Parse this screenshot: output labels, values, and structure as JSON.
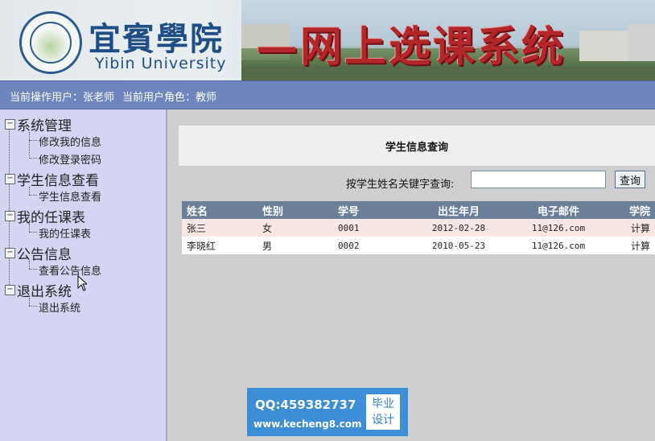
{
  "header": {
    "school_cn": "宜賓學院",
    "school_en": "Yibin University",
    "system_title": "—网上选课系统"
  },
  "userbar": {
    "user_label": "当前操作用户：张老师",
    "role_label": "当前用户角色：教师"
  },
  "sidebar": {
    "groups": [
      {
        "title": "系统管理",
        "items": [
          "修改我的信息",
          "修改登录密码"
        ]
      },
      {
        "title": "学生信息查看",
        "items": [
          "学生信息查看"
        ]
      },
      {
        "title": "我的任课表",
        "items": [
          "我的任课表"
        ]
      },
      {
        "title": "公告信息",
        "items": [
          "查看公告信息"
        ]
      },
      {
        "title": "退出系统",
        "items": [
          "退出系统"
        ]
      }
    ],
    "toggle_symbol": "−"
  },
  "main": {
    "query_title": "学生信息查询",
    "search": {
      "label": "按学生姓名关键字查询:",
      "value": "",
      "button_label": "查询"
    },
    "table": {
      "columns": [
        "姓名",
        "性别",
        "学号",
        "出生年月",
        "电子邮件",
        "学院"
      ],
      "rows": [
        [
          "张三",
          "女",
          "0001",
          "2012-02-28",
          "11@126.com",
          "计算"
        ],
        [
          "李晓红",
          "男",
          "0002",
          "2010-05-23",
          "11@126.com",
          "计算"
        ]
      ]
    }
  },
  "watermark": {
    "qq": "QQ:459382737",
    "site": "www.kecheng8.com",
    "badge_line1": "毕业",
    "badge_line2": "设计"
  },
  "colors": {
    "userbar": "#6e86bd",
    "sidebar": "#d3d5f2",
    "table_header": "#6b7f98",
    "title_red": "#b3262a",
    "logo_blue": "#1f4e86"
  }
}
